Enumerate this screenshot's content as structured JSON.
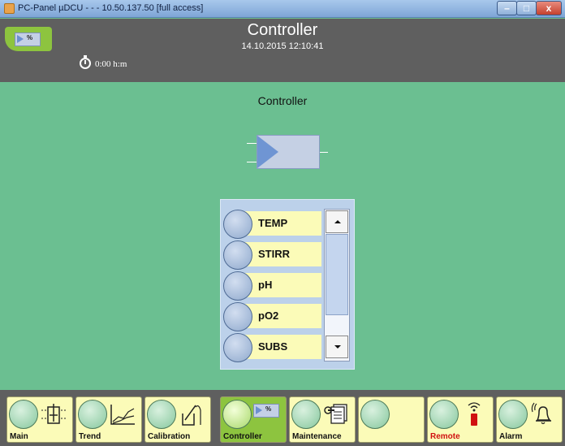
{
  "window": {
    "title": "PC-Panel µDCU - - - 10.50.137.50 [full access]",
    "controls": [
      "minimize",
      "maximize",
      "close"
    ]
  },
  "header": {
    "mode_badge": "%",
    "timer": "0:00 h:m",
    "title": "Controller",
    "datetime": "14.10.2015  12:10:41"
  },
  "main": {
    "title": "Controller",
    "controller_badge": "",
    "list": {
      "items": [
        {
          "label": "TEMP"
        },
        {
          "label": "STIRR"
        },
        {
          "label": "pH"
        },
        {
          "label": "pO2"
        },
        {
          "label": "SUBS"
        }
      ],
      "scroll_position": 0.75
    }
  },
  "nav": {
    "items": [
      {
        "label": "Main",
        "icon": "bioreactor-icon",
        "active": false
      },
      {
        "label": "Trend",
        "icon": "trend-icon",
        "active": false
      },
      {
        "label": "Calibration",
        "icon": "calibration-icon",
        "active": false
      },
      {
        "label": "Controller",
        "icon": "controller-icon",
        "active": true,
        "badge": "%"
      },
      {
        "label": "Maintenance",
        "icon": "maintenance-icon",
        "active": false
      },
      {
        "label": "",
        "icon": "",
        "active": false
      },
      {
        "label": "Remote",
        "icon": "remote-icon",
        "active": false
      },
      {
        "label": "Alarm",
        "icon": "bell-icon",
        "active": false
      }
    ]
  },
  "colors": {
    "background": "#6bbf91",
    "header": "#5f5f5f",
    "active": "#8dc43f",
    "button": "#fbfbb8",
    "remote_label": "#d01010"
  }
}
